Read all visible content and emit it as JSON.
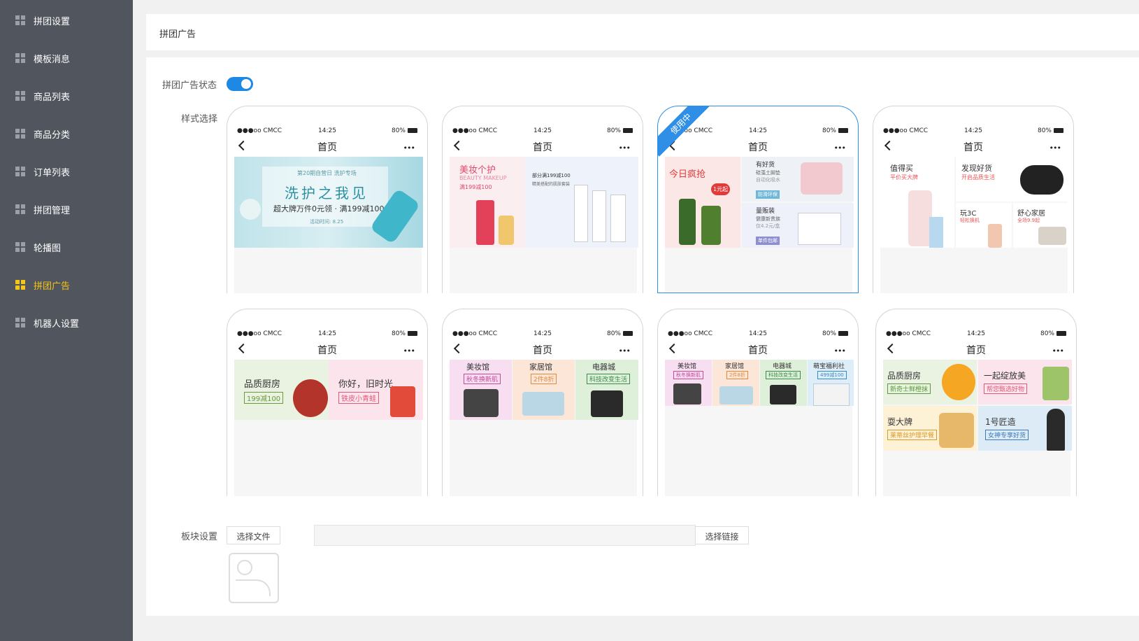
{
  "sidebar": {
    "items": [
      {
        "label": "拼团设置"
      },
      {
        "label": "模板消息"
      },
      {
        "label": "商品列表"
      },
      {
        "label": "商品分类"
      },
      {
        "label": "订单列表"
      },
      {
        "label": "拼团管理"
      },
      {
        "label": "轮播图"
      },
      {
        "label": "拼团广告",
        "active": true
      },
      {
        "label": "机器人设置"
      }
    ],
    "active_color": "#f5c518"
  },
  "header": {
    "title": "拼团广告"
  },
  "form": {
    "status_label": "拼团广告状态",
    "status_on": true,
    "style_label": "样式选择",
    "block_label": "板块设置",
    "choose_file": "选择文件",
    "choose_link": "选择链接",
    "link_value": ""
  },
  "phone": {
    "carrier": "●●●oo CMCC",
    "time": "14:25",
    "battery": "80%",
    "page_title": "首页",
    "more": "•••"
  },
  "styles": [
    {
      "id": 1,
      "in_use": false,
      "texts": {
        "a": "第20期自营日 洗护专场",
        "b": "洗护之我见",
        "c": "超大牌万件0元领 · 满199减100",
        "d": "活动时间: 8.25"
      }
    },
    {
      "id": 2,
      "in_use": false,
      "texts": {
        "a": "美妆个护",
        "b": "BEAUTY MAKEUP",
        "c": "满199减100",
        "d": "部分满199减100",
        "e": "精美搭配的肌肤套装"
      }
    },
    {
      "id": 3,
      "in_use": true,
      "badge": "使用中",
      "texts": {
        "a": "今日疯抢",
        "b": "1元起",
        "c": "有好货",
        "d": "硅藻土脚垫",
        "e": "自动化吸水",
        "f": "防滑环保",
        "g": "量贩装",
        "h": "健康新贵族",
        "i": "仅4.2元/盒",
        "j": "单件包邮"
      }
    },
    {
      "id": 4,
      "in_use": false,
      "texts": {
        "a": "值得买",
        "b": "平价买大牌",
        "c": "发现好货",
        "d": "开启品质生活",
        "e": "玩3C",
        "f": "轻松换机",
        "g": "舒心家居",
        "h": "全场9.9起"
      }
    },
    {
      "id": 5,
      "in_use": false,
      "texts": {
        "a": "品质厨房",
        "b": "199减100",
        "c": "你好，旧时光",
        "d": "铁皮小青蛙"
      }
    },
    {
      "id": 6,
      "in_use": false,
      "texts": {
        "a": "美妆馆",
        "b": "秋冬换新肌",
        "c": "家居馆",
        "d": "2件8折",
        "e": "电器城",
        "f": "科技改变生活"
      }
    },
    {
      "id": 7,
      "in_use": false,
      "texts": {
        "a": "美妆馆",
        "b": "秋冬换新肌",
        "c": "家居馆",
        "d": "2件8折",
        "e": "电器城",
        "f": "科技改变生活",
        "g": "萌宝福利社",
        "h": "499减100"
      }
    },
    {
      "id": 8,
      "in_use": false,
      "texts": {
        "a": "品质厨房",
        "b": "新奇士鲜橙抹",
        "c": "一起绽放美",
        "d": "帮您甄选好物",
        "e": "耍大牌",
        "f": "莱蒂丝护理早餐",
        "g": "1号匠造",
        "h": "女神专享好货"
      }
    }
  ],
  "colors": {
    "accent": "#1e88e5",
    "sidebar_bg": "#50555e",
    "selected_border": "#2f8fe6"
  }
}
